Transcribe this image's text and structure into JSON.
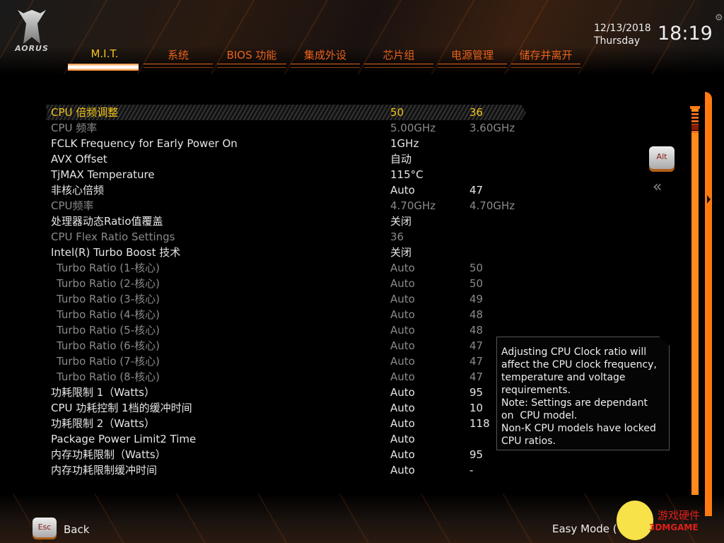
{
  "brand": "AORUS",
  "tabs": [
    "M.I.T.",
    "系统",
    "BIOS 功能",
    "集成外设",
    "芯片组",
    "电源管理",
    "储存并离开"
  ],
  "date": "12/13/2018",
  "weekday": "Thursday",
  "time": "18:19",
  "rows": [
    {
      "label": "CPU 倍频调整",
      "v1": "50",
      "v2": "36"
    },
    {
      "label": "CPU 频率",
      "v1": "5.00GHz",
      "v2": "3.60GHz"
    },
    {
      "label": "FCLK Frequency for Early Power On",
      "v1": "1GHz",
      "v2": ""
    },
    {
      "label": "AVX Offset",
      "v1": "自动",
      "v2": ""
    },
    {
      "label": "TjMAX Temperature",
      "v1": "115°C",
      "v2": ""
    },
    {
      "label": "非核心倍频",
      "v1": "Auto",
      "v2": "47"
    },
    {
      "label": "CPU频率",
      "v1": "4.70GHz",
      "v2": "4.70GHz"
    },
    {
      "label": "处理器动态Ratio值覆盖",
      "v1": "关闭",
      "v2": ""
    },
    {
      "label": "CPU Flex Ratio Settings",
      "v1": "36",
      "v2": ""
    },
    {
      "label": "Intel(R) Turbo Boost 技术",
      "v1": "关闭",
      "v2": ""
    },
    {
      "label": "Turbo Ratio (1-核心)",
      "v1": "Auto",
      "v2": "50"
    },
    {
      "label": "Turbo Ratio (2-核心)",
      "v1": "Auto",
      "v2": "50"
    },
    {
      "label": "Turbo Ratio (3-核心)",
      "v1": "Auto",
      "v2": "49"
    },
    {
      "label": "Turbo Ratio (4-核心)",
      "v1": "Auto",
      "v2": "48"
    },
    {
      "label": "Turbo Ratio (5-核心)",
      "v1": "Auto",
      "v2": "48"
    },
    {
      "label": "Turbo Ratio (6-核心)",
      "v1": "Auto",
      "v2": "47"
    },
    {
      "label": "Turbo Ratio (7-核心)",
      "v1": "Auto",
      "v2": "47"
    },
    {
      "label": "Turbo Ratio (8-核心)",
      "v1": "Auto",
      "v2": "47"
    },
    {
      "label": "功耗限制 1（Watts）",
      "v1": "Auto",
      "v2": "95"
    },
    {
      "label": "CPU 功耗控制 1档的缓冲时间",
      "v1": "Auto",
      "v2": "10"
    },
    {
      "label": "功耗限制 2（Watts）",
      "v1": "Auto",
      "v2": "118"
    },
    {
      "label": "Package Power Limit2 Time",
      "v1": "Auto",
      "v2": ""
    },
    {
      "label": "内存功耗限制（Watts）",
      "v1": "Auto",
      "v2": "95"
    },
    {
      "label": "内存功耗限制缓冲时间",
      "v1": "Auto",
      "v2": "-"
    }
  ],
  "help": "Adjusting CPU Clock ratio will affect the CPU clock frequency, temperature and voltage requirements.\nNote: Settings are dependant  on  CPU model.\nNon-K CPU models have locked CPU ratios.",
  "alt_key": "Alt",
  "esc_key": "Esc",
  "back": "Back",
  "easy_mode": "Easy Mode (",
  "watermark": {
    "line1": "游戏硬件",
    "line2": "3DMGAME"
  }
}
